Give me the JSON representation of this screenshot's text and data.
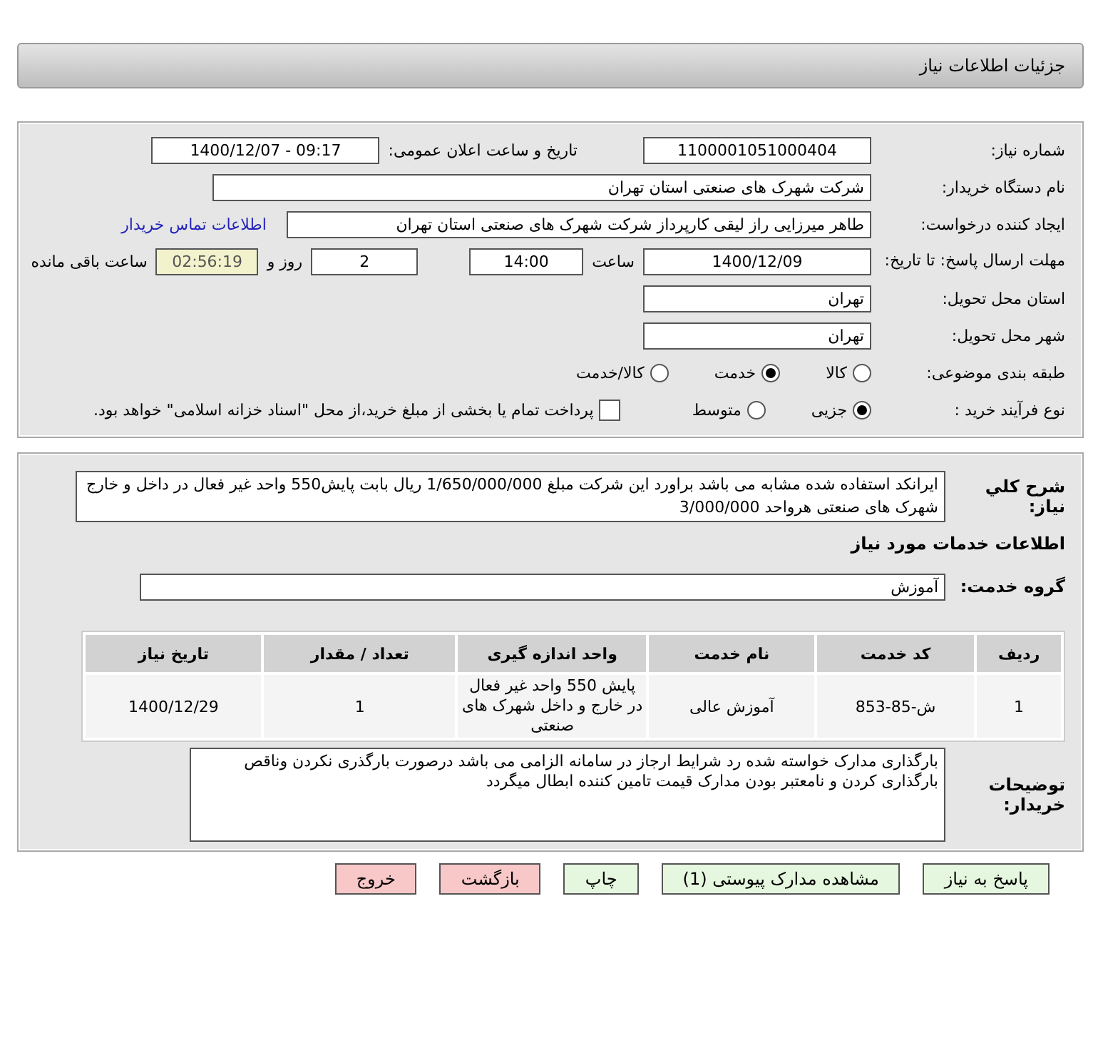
{
  "header": {
    "title": "جزئیات اطلاعات نیاز"
  },
  "details": {
    "need_number": {
      "label": "شماره نیاز:",
      "value": "1100001051000404"
    },
    "announce": {
      "label": "تاریخ و ساعت اعلان عمومی:",
      "value": "1400/12/07 - 09:17"
    },
    "buyer": {
      "label": "نام دستگاه خریدار:",
      "value": "شرکت شهرک های صنعتی استان تهران"
    },
    "creator": {
      "label": "ایجاد کننده درخواست:",
      "value": "طاهر  میرزایی راز لیقی کارپرداز شرکت شهرک های صنعتی استان تهران",
      "link": "اطلاعات تماس خریدار"
    },
    "deadline": {
      "label": "مهلت ارسال پاسخ: تا تاریخ:",
      "date": "1400/12/09",
      "time_label": "ساعت",
      "time": "14:00",
      "days": "2",
      "days_label": "روز و",
      "remaining": "02:56:19",
      "remaining_label": "ساعت باقی مانده"
    },
    "province": {
      "label": "استان محل تحویل:",
      "value": "تهران"
    },
    "city": {
      "label": "شهر محل تحویل:",
      "value": "تهران"
    },
    "category": {
      "label": "طبقه بندی موضوعی:",
      "options": [
        {
          "label": "کالا",
          "selected": false
        },
        {
          "label": "خدمت",
          "selected": true
        },
        {
          "label": "کالا/خدمت",
          "selected": false
        }
      ]
    },
    "process": {
      "label": "نوع فرآیند خرید :",
      "options": [
        {
          "label": "جزیی",
          "selected": true
        },
        {
          "label": "متوسط",
          "selected": false
        }
      ],
      "payment": {
        "label": "پرداخت تمام یا بخشی از مبلغ خرید،از محل \"اسناد خزانه اسلامی\" خواهد بود.",
        "checked": false
      }
    }
  },
  "needs": {
    "description": {
      "label": "شرح کلي نیاز:",
      "value": "ایرانکد استفاده شده مشابه می باشد براورد این شرکت مبلغ 1/650/000/000 ریال بابت پایش550 واحد غیر فعال در داخل و خارج شهرک های صنعتی هرواحد 3/000/000"
    },
    "services_heading": "اطلاعات خدمات مورد نیاز",
    "service_group": {
      "label": "گروه خدمت:",
      "value": "آموزش"
    },
    "table": {
      "columns": [
        "ردیف",
        "کد خدمت",
        "نام خدمت",
        "واحد اندازه گیری",
        "تعداد / مقدار",
        "تاریخ نیاز"
      ],
      "rows": [
        [
          "1",
          "ش-85-853",
          "آموزش عالی",
          "پایش 550 واحد غیر فعال در خارج و داخل شهرک های صنعتی",
          "1",
          "1400/12/29"
        ]
      ]
    },
    "buyer_notes": {
      "label": "توضیحات خریدار:",
      "value": "بارگذاری مدارک خواسته شده رد شرایط ارجاز در سامانه الزامی می باشد درصورت بارگذری نکردن وناقص بارگذاری کردن و نامعتبر بودن مدارک قیمت تامین کننده ابطال  میگردد"
    }
  },
  "buttons": [
    {
      "label": "پاسخ به نیاز",
      "kind": "normal"
    },
    {
      "label": "مشاهده مدارک پیوستی (1)",
      "kind": "normal"
    },
    {
      "label": "چاپ",
      "kind": "normal"
    },
    {
      "label": "بازگشت",
      "kind": "danger"
    },
    {
      "label": "خروج",
      "kind": "danger"
    }
  ]
}
